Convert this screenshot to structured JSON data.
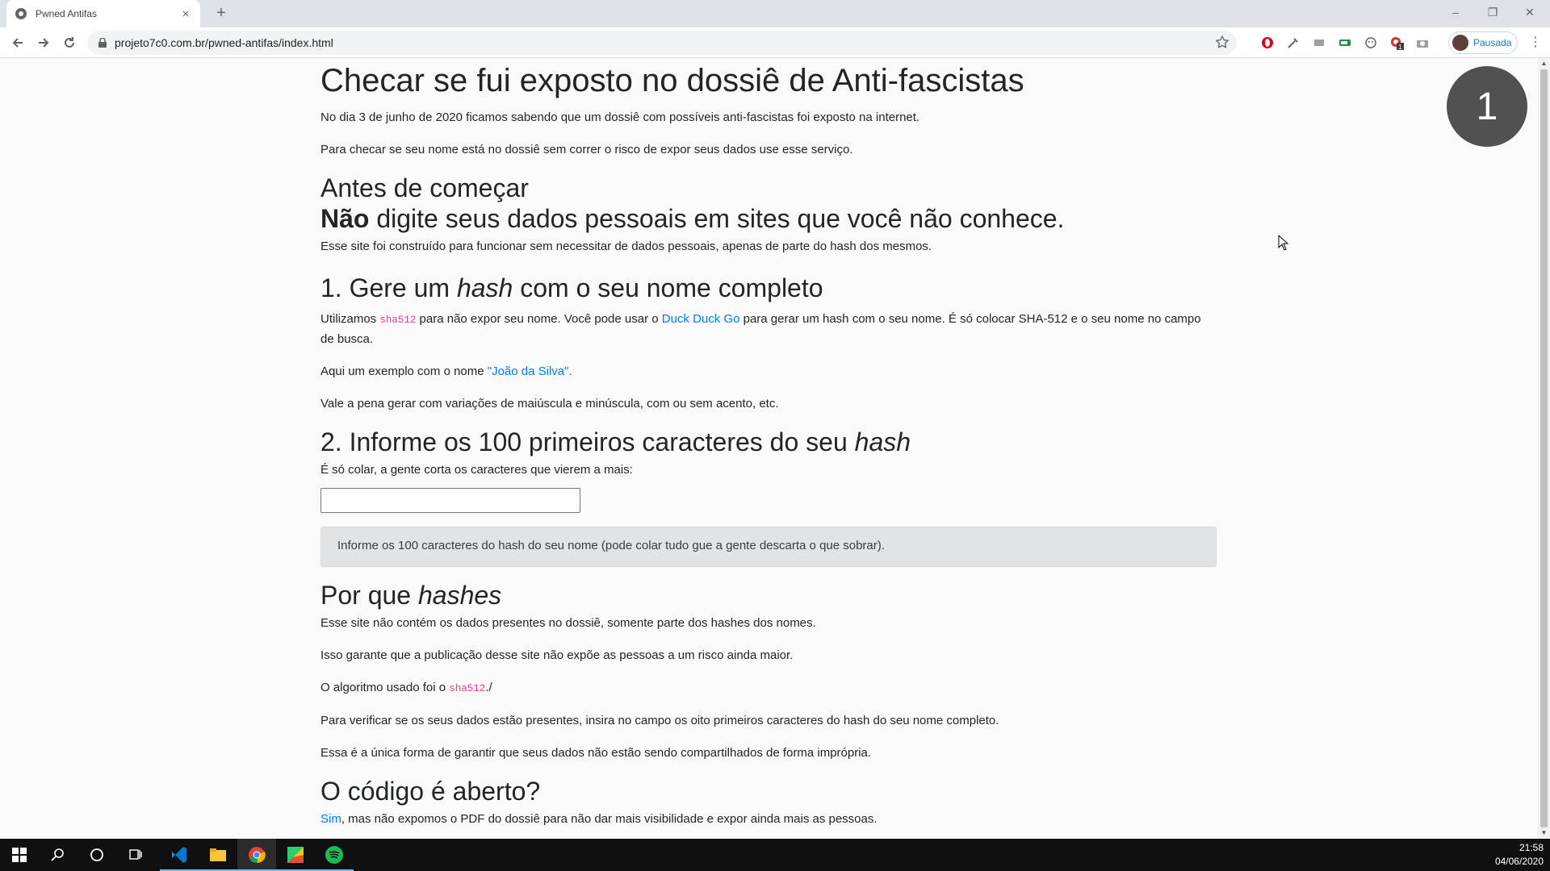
{
  "browser": {
    "tab_title": "Pwned Antifas",
    "tab_close": "×",
    "new_tab": "+",
    "url": "projeto7c0.com.br/pwned-antifas/index.html",
    "profile_status": "Pausada",
    "window_controls": [
      "–",
      "❐",
      "✕"
    ],
    "extension_icons": [
      "opera-icon",
      "eyedropper-icon",
      "cast-icon",
      "battery-icon",
      "face-icon",
      "notification-icon",
      "camera-icon"
    ],
    "extension_badge": "1"
  },
  "page": {
    "title": "Checar se fui exposto no dossiê de Anti-fascistas",
    "intro": "No dia 3 de junho de 2020 ficamos sabendo que um dossiê com possíveis anti-fascistas foi exposto na internet.",
    "intro2": "Para checar se seu nome está no dossiê sem correr o risco de expor seus dados use esse serviço.",
    "before_heading": "Antes de começar",
    "warning_bold": "Não",
    "warning_rest": " digite seus dados pessoais em sites que você não conhece.",
    "warning_text": "Esse site foi construído para funcionar sem necessitar de dados pessoais, apenas de parte do hash dos mesmos.",
    "step1": {
      "heading_a": "1. Gere um ",
      "heading_em": "hash",
      "heading_b": " com o seu nome completo",
      "p1_a": "Utilizamos ",
      "p1_code": "sha512",
      "p1_b": " para não expor seu nome. Você pode usar o ",
      "p1_link": "Duck Duck Go",
      "p1_c": " para gerar um hash com o seu nome. É só colocar SHA-512 e o seu nome no campo de busca.",
      "p2_a": "Aqui um exemplo com o nome ",
      "p2_link": "\"João da Silva\".",
      "p3": "Vale a pena gerar com variações de maiúscula e minúscula, com ou sem acento, etc."
    },
    "step2": {
      "heading_a": "2. Informe os 100 primeiros caracteres do seu ",
      "heading_em": "hash",
      "p1": "É só colar, a gente corta os caracteres que vierem a mais:",
      "input_value": "",
      "alert": "Informe os 100 caracteres do hash do seu nome (pode colar tudo gue a gente descarta o que sobrar)."
    },
    "why": {
      "heading_a": "Por que ",
      "heading_em": "hashes",
      "p1": "Esse site não contém os dados presentes no dossiê, somente parte dos hashes dos nomes.",
      "p2": "Isso garante que a publicação desse site não expõe as pessoas a um risco ainda maior.",
      "p3_a": "O algoritmo usado foi o ",
      "p3_code": "sha512",
      "p3_b": "./",
      "p4": "Para verificar se os seus dados estão presentes, insira no campo os oito primeiros caracteres do hash do seu nome completo.",
      "p5": "Essa é a única forma de garantir que seus dados não estão sendo compartilhados de forma imprópria."
    },
    "open": {
      "heading": "O código é aberto?",
      "p1_link": "Sim",
      "p1_rest": ", mas não expomos o PDF do dossiê para não dar mais visibilidade e expor ainda mais as pessoas."
    },
    "step_badge": "1"
  },
  "taskbar": {
    "time": "21:58",
    "date": "04/06/2020",
    "apps": [
      "windows-start-icon",
      "search-icon",
      "cortana-icon",
      "task-view-icon",
      "vscode-icon",
      "file-explorer-icon",
      "chrome-icon",
      "color-app-icon",
      "spotify-icon"
    ]
  },
  "colors": {
    "link": "#007bff",
    "code": "#e83e8c",
    "alert_bg": "#e2e3e5",
    "badge_bg": "#515151",
    "taskbar": "#101010"
  }
}
